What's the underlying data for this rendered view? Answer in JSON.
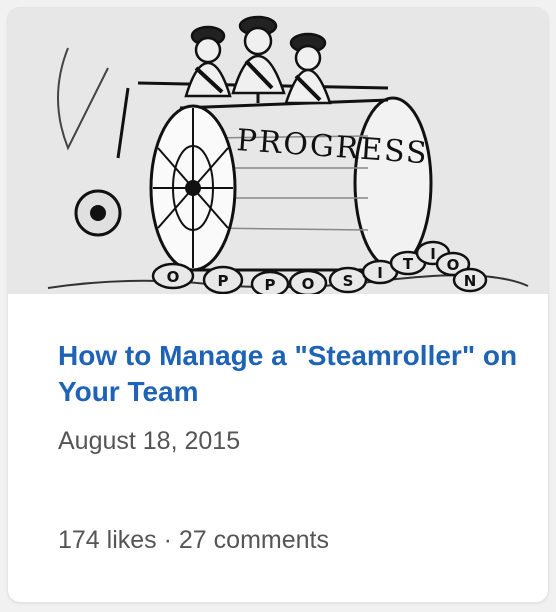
{
  "post": {
    "image": {
      "roller_text": "PROGRESS",
      "pebble_letters": [
        "O",
        "P",
        "P",
        "O",
        "S",
        "I",
        "T",
        "I",
        "O",
        "N"
      ]
    },
    "title": "How to Manage a \"Steamroller\" on Your Team",
    "date": "August 18, 2015",
    "likes": "174 likes",
    "separator": "·",
    "comments": "27 comments"
  }
}
